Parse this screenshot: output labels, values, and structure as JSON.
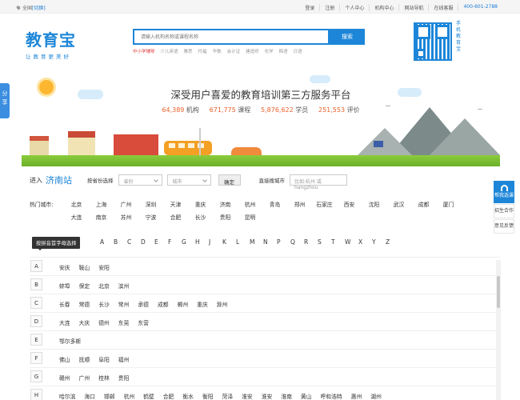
{
  "topbar": {
    "location": "全国",
    "switch": "[切换]",
    "nav": [
      "登录",
      "注册",
      "个人中心",
      "机构中心",
      "网站导航",
      "在线客服"
    ],
    "phone": "400-601-2788"
  },
  "header": {
    "logo": "教育宝",
    "logo_sub": "让教育更美好",
    "search_placeholder": "请输入机构名称或课程名称",
    "search_button": "搜索",
    "hotwords": [
      "中小学辅导",
      "少儿英语",
      "雅思",
      "托福",
      "华数",
      "会计证",
      "建造师",
      "化学",
      "韩语",
      "日语"
    ],
    "qr_text": "手机教育宝"
  },
  "side": {
    "share": "分享",
    "right": [
      "帮我选课",
      "招生合作",
      "意见反馈"
    ]
  },
  "banner": {
    "slogan": "深受用户喜爱的教育培训第三方服务平台",
    "stats": [
      {
        "num": "64,389",
        "label": "机构"
      },
      {
        "num": "671,775",
        "label": "课程"
      },
      {
        "num": "5,876,622",
        "label": "学员"
      },
      {
        "num": "251,553",
        "label": "评价"
      }
    ]
  },
  "city_select": {
    "enter": "进入",
    "current": "济南站",
    "province_label": "按省份选择",
    "province_placeholder": "省份",
    "city_placeholder": "城市",
    "ok": "确定",
    "direct_label": "直接搜城市",
    "direct_placeholder": "比如:杭州 或 hangzhou"
  },
  "hot": {
    "label": "热门城市:",
    "cities": [
      "北京",
      "上海",
      "广州",
      "深圳",
      "天津",
      "重庆",
      "济南",
      "杭州",
      "青岛",
      "郑州",
      "石家庄",
      "西安",
      "沈阳",
      "武汉",
      "成都",
      "厦门",
      "大连",
      "南京",
      "苏州",
      "宁波",
      "合肥",
      "长沙",
      "贵阳",
      "昆明"
    ]
  },
  "pinyin": {
    "tip": "按拼音首字母选择",
    "letters": [
      "A",
      "B",
      "C",
      "D",
      "E",
      "F",
      "G",
      "H",
      "J",
      "K",
      "L",
      "M",
      "N",
      "P",
      "Q",
      "R",
      "S",
      "T",
      "W",
      "X",
      "Y",
      "Z"
    ]
  },
  "groups": [
    {
      "letter": "A",
      "cities": [
        "安庆",
        "鞍山",
        "安阳"
      ]
    },
    {
      "letter": "B",
      "cities": [
        "蚌埠",
        "保定",
        "北京",
        "滨州"
      ]
    },
    {
      "letter": "C",
      "cities": [
        "长春",
        "常德",
        "长沙",
        "常州",
        "承德",
        "成都",
        "郴州",
        "重庆",
        "滁州"
      ]
    },
    {
      "letter": "D",
      "cities": [
        "大连",
        "大庆",
        "德州",
        "东莞",
        "东营"
      ]
    },
    {
      "letter": "E",
      "cities": [
        "鄂尔多斯"
      ]
    },
    {
      "letter": "F",
      "cities": [
        "佛山",
        "抚顺",
        "阜阳",
        "福州"
      ]
    },
    {
      "letter": "G",
      "cities": [
        "赣州",
        "广州",
        "桂林",
        "贵阳"
      ]
    },
    {
      "letter": "H",
      "cities": [
        "哈尔滨",
        "海口",
        "邯郸",
        "杭州",
        "鹤壁",
        "合肥",
        "衡水",
        "衡阳",
        "菏泽",
        "淮安",
        "淮安",
        "淮南",
        "黄山",
        "呼和浩特",
        "惠州",
        "湖州"
      ]
    }
  ]
}
